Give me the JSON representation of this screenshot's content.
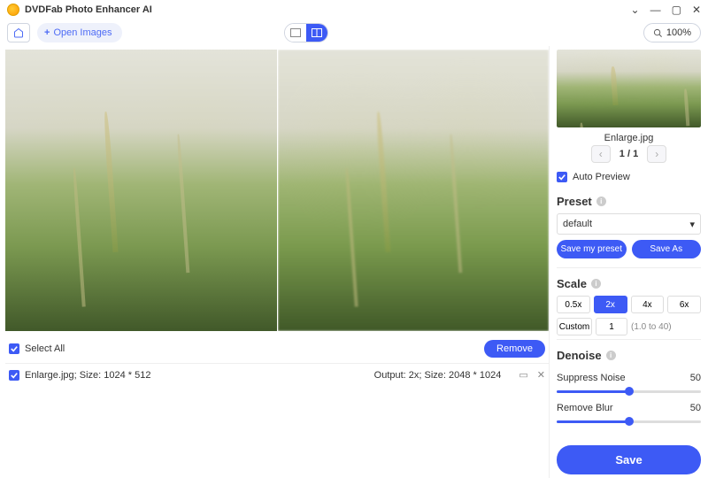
{
  "app": {
    "title": "DVDFab Photo Enhancer AI"
  },
  "toolbar": {
    "open_images": "Open Images",
    "zoom": "100%"
  },
  "list": {
    "select_all": "Select All",
    "remove": "Remove",
    "file_label": "Enlarge.jpg; Size: 1024 * 512",
    "output_label": "Output: 2x; Size: 2048 * 1024"
  },
  "sidebar": {
    "filename": "Enlarge.jpg",
    "counter": "1 / 1",
    "auto_preview": "Auto Preview",
    "preset_title": "Preset",
    "preset_value": "default",
    "save_preset": "Save my preset",
    "save_as": "Save As",
    "scale_title": "Scale",
    "scales": [
      "0.5x",
      "2x",
      "4x",
      "6x"
    ],
    "scale_active": "2x",
    "custom": "Custom",
    "custom_value": "1",
    "scale_range": "(1.0 to 40)",
    "denoise_title": "Denoise",
    "suppress_label": "Suppress Noise",
    "suppress_value": "50",
    "blur_label": "Remove Blur",
    "blur_value": "50",
    "save": "Save"
  }
}
